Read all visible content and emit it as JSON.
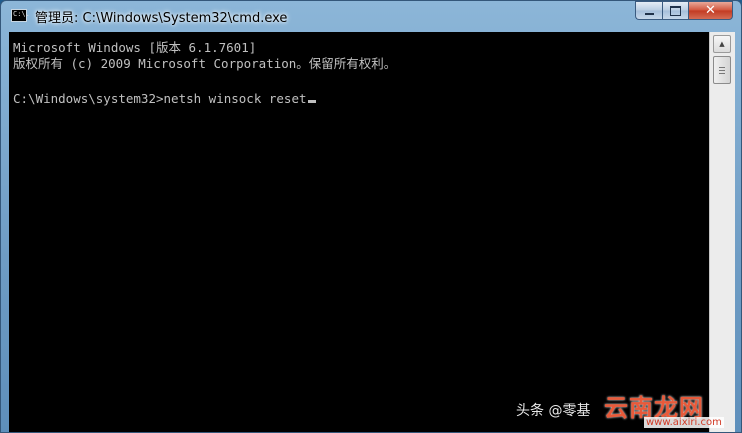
{
  "window": {
    "title": "管理员: C:\\Windows\\System32\\cmd.exe",
    "icon_name": "cmd-icon",
    "icon_glyph": "C:\\.",
    "controls": {
      "minimize_icon": "minimize-icon",
      "maximize_icon": "maximize-icon",
      "close_icon": "close-icon",
      "close_glyph": "✕"
    }
  },
  "console": {
    "lines": [
      "Microsoft Windows [版本 6.1.7601]",
      "版权所有 (c) 2009 Microsoft Corporation。保留所有权利。",
      "",
      "C:\\Windows\\system32>netsh winsock reset"
    ],
    "text_color": "#c0c0c0",
    "background_color": "#000000"
  },
  "scrollbar": {
    "up_arrow_icon": "scroll-up-arrow-icon",
    "up_arrow_glyph": "▲"
  },
  "watermark": {
    "source": "头条 @零基",
    "site_name": "云南龙网",
    "site_url": "www.aixiri.com"
  }
}
